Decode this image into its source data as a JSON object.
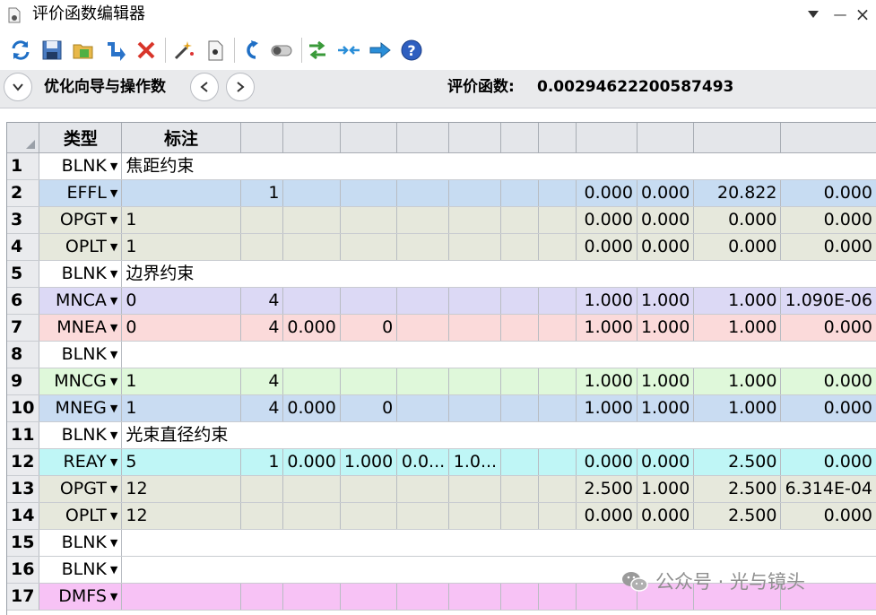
{
  "window": {
    "title": "评价函数编辑器",
    "menu_icon": "triangle-down-icon",
    "minimize_glyph": "—",
    "close_glyph": "×"
  },
  "toolbar": {
    "icons": [
      "refresh-icon",
      "save-icon",
      "load-icon",
      "insert-icon",
      "delete-icon",
      "wizard-icon",
      "settings-icon",
      "undo-icon",
      "toggle-icon",
      "swap-icon",
      "compress-icon",
      "arrow-right-icon",
      "help-icon"
    ]
  },
  "nav": {
    "wizard_label": "优化向导与操作数",
    "merit_label": "评价函数:",
    "merit_value": "0.00294622200587493"
  },
  "grid": {
    "headers": [
      "类型",
      "标注",
      "",
      "",
      "",
      "",
      "",
      "",
      "",
      "",
      "",
      "",
      ""
    ],
    "rows": [
      {
        "n": "1",
        "type": "BLNK",
        "cells": [
          "焦距约束",
          "",
          "",
          "",
          "",
          "",
          "",
          "",
          "",
          "",
          "",
          ""
        ]
      },
      {
        "n": "2",
        "type": "EFFL",
        "cells": [
          "",
          "1",
          "",
          "",
          "",
          "",
          "",
          "",
          "0.000",
          "0.000",
          "20.822",
          "0.000"
        ]
      },
      {
        "n": "3",
        "type": "OPGT",
        "cells": [
          "1",
          "",
          "",
          "",
          "",
          "",
          "",
          "",
          "0.000",
          "0.000",
          "0.000",
          "0.000"
        ]
      },
      {
        "n": "4",
        "type": "OPLT",
        "cells": [
          "1",
          "",
          "",
          "",
          "",
          "",
          "",
          "",
          "0.000",
          "0.000",
          "0.000",
          "0.000"
        ]
      },
      {
        "n": "5",
        "type": "BLNK",
        "cells": [
          "边界约束",
          "",
          "",
          "",
          "",
          "",
          "",
          "",
          "",
          "",
          "",
          ""
        ]
      },
      {
        "n": "6",
        "type": "MNCA",
        "cells": [
          "0",
          "4",
          "",
          "",
          "",
          "",
          "",
          "",
          "1.000",
          "1.000",
          "1.000",
          "1.090E-06"
        ]
      },
      {
        "n": "7",
        "type": "MNEA",
        "cells": [
          "0",
          "4",
          "0.000",
          "0",
          "",
          "",
          "",
          "",
          "1.000",
          "1.000",
          "1.000",
          "0.000"
        ]
      },
      {
        "n": "8",
        "type": "BLNK",
        "cells": [
          "",
          "",
          "",
          "",
          "",
          "",
          "",
          "",
          "",
          "",
          "",
          ""
        ]
      },
      {
        "n": "9",
        "type": "MNCG",
        "cells": [
          "1",
          "4",
          "",
          "",
          "",
          "",
          "",
          "",
          "1.000",
          "1.000",
          "1.000",
          "0.000"
        ]
      },
      {
        "n": "10",
        "type": "MNEG",
        "cells": [
          "1",
          "4",
          "0.000",
          "0",
          "",
          "",
          "",
          "",
          "1.000",
          "1.000",
          "1.000",
          "0.000"
        ]
      },
      {
        "n": "11",
        "type": "BLNK",
        "cells": [
          "光束直径约束",
          "",
          "",
          "",
          "",
          "",
          "",
          "",
          "",
          "",
          "",
          ""
        ]
      },
      {
        "n": "12",
        "type": "REAY",
        "cells": [
          "5",
          "1",
          "0.000",
          "1.000",
          "0.0...",
          "1.0...",
          "",
          "",
          "0.000",
          "0.000",
          "2.500",
          "0.000"
        ]
      },
      {
        "n": "13",
        "type": "OPGT",
        "cells": [
          "12",
          "",
          "",
          "",
          "",
          "",
          "",
          "",
          "2.500",
          "1.000",
          "2.500",
          "6.314E-04"
        ]
      },
      {
        "n": "14",
        "type": "OPLT",
        "cells": [
          "12",
          "",
          "",
          "",
          "",
          "",
          "",
          "",
          "0.000",
          "0.000",
          "2.500",
          "0.000"
        ]
      },
      {
        "n": "15",
        "type": "BLNK",
        "cells": [
          "",
          "",
          "",
          "",
          "",
          "",
          "",
          "",
          "",
          "",
          "",
          ""
        ]
      },
      {
        "n": "16",
        "type": "BLNK",
        "cells": [
          "",
          "",
          "",
          "",
          "",
          "",
          "",
          "",
          "",
          "",
          "",
          ""
        ]
      },
      {
        "n": "17",
        "type": "DMFS",
        "cells": [
          "",
          "",
          "",
          "",
          "",
          "",
          "",
          "",
          "",
          "",
          "",
          ""
        ]
      }
    ]
  },
  "watermark": {
    "text": "公众号 · 光与镜头",
    "icon": "wechat-icon"
  }
}
